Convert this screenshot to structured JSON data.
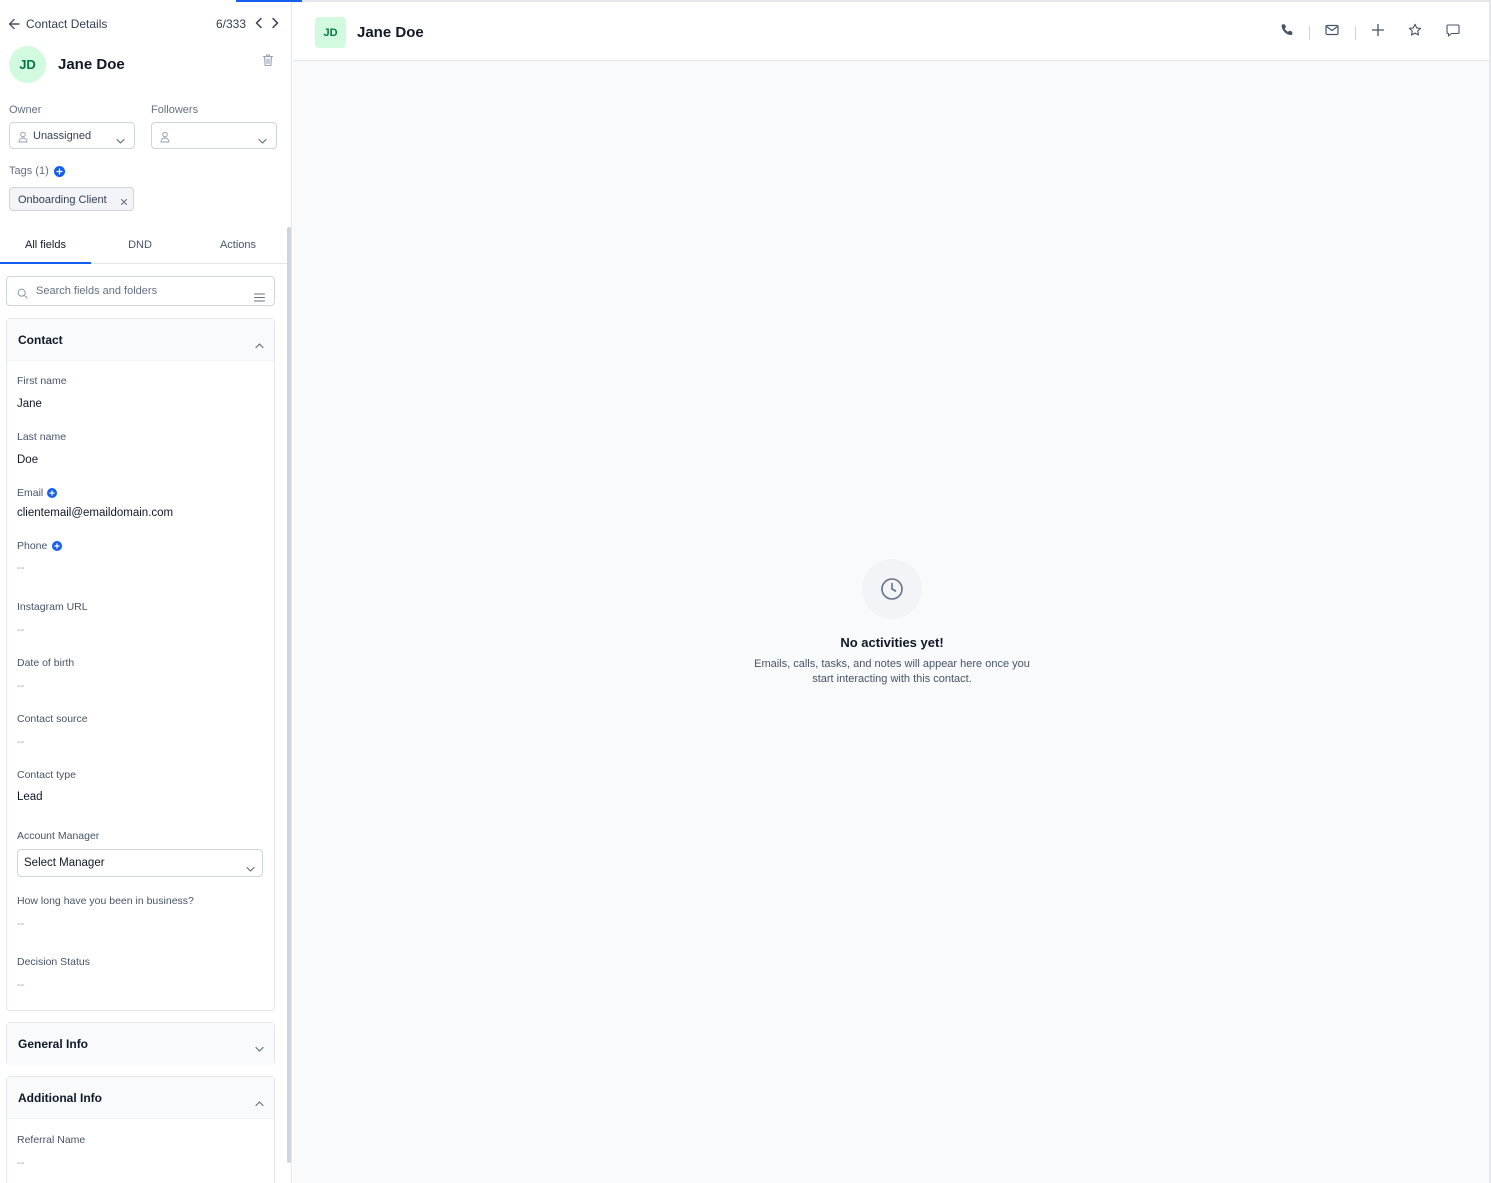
{
  "sidebar": {
    "title": "Contact Details",
    "pager": "6/333",
    "avatar_initials": "JD",
    "contact_name": "Jane Doe",
    "owner": {
      "label": "Owner",
      "value": "Unassigned"
    },
    "followers": {
      "label": "Followers",
      "value": ""
    },
    "tags": {
      "label": "Tags (1)",
      "items": [
        "Onboarding Client"
      ]
    },
    "tabs": [
      "All fields",
      "DND",
      "Actions"
    ],
    "active_tab": "All fields",
    "search": {
      "placeholder": "Search fields and folders",
      "value": ""
    },
    "sections": {
      "contact": {
        "title": "Contact",
        "expanded": true,
        "fields": {
          "first_name": {
            "label": "First name",
            "value": "Jane"
          },
          "last_name": {
            "label": "Last name",
            "value": "Doe"
          },
          "email": {
            "label": "Email",
            "value": "clientemail@emaildomain.com"
          },
          "phone": {
            "label": "Phone",
            "value": "--"
          },
          "instagram": {
            "label": "Instagram URL",
            "value": "--"
          },
          "dob": {
            "label": "Date of birth",
            "value": "--"
          },
          "source": {
            "label": "Contact source",
            "value": "--"
          },
          "type": {
            "label": "Contact type",
            "value": "Lead"
          },
          "account_manager": {
            "label": "Account Manager",
            "value": "Select Manager"
          },
          "business_length": {
            "label": "How long have you been in business?",
            "value": "--"
          },
          "decision_status": {
            "label": "Decision Status",
            "value": "--"
          }
        }
      },
      "general": {
        "title": "General Info",
        "expanded": false
      },
      "additional": {
        "title": "Additional Info",
        "expanded": true,
        "fields": {
          "referral_name": {
            "label": "Referral Name",
            "value": "--"
          }
        }
      }
    }
  },
  "main": {
    "avatar_initials": "JD",
    "contact_name": "Jane Doe",
    "header_icons": [
      "phone-icon",
      "mail-icon",
      "plus-icon",
      "star-icon",
      "comment-icon"
    ],
    "empty_state": {
      "icon": "clock-icon",
      "title": "No activities yet!",
      "description": "Emails, calls, tasks, and notes will appear here once you start interacting with this contact."
    }
  },
  "colors": {
    "accent": "#155eef",
    "avatar_bg": "#d1fadf",
    "avatar_text": "#067647"
  }
}
